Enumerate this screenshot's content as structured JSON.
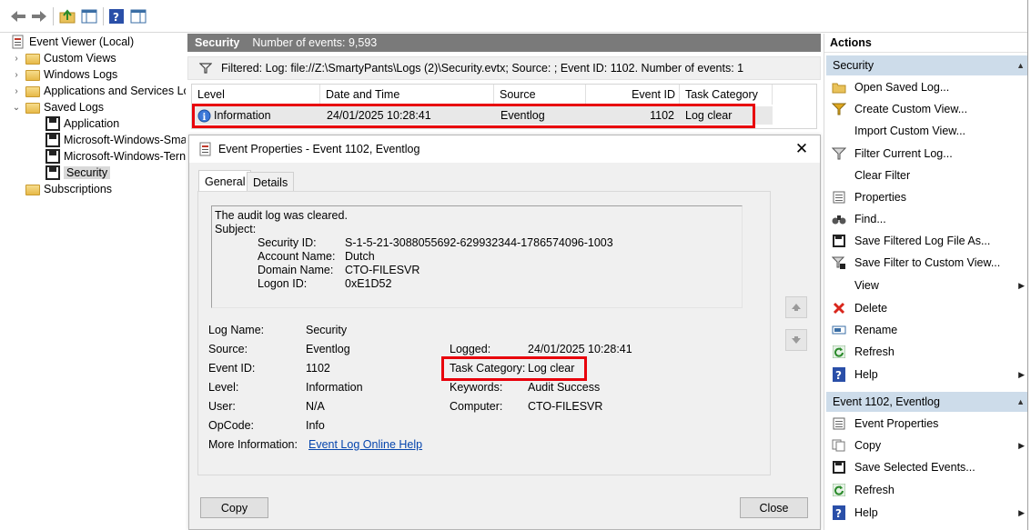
{
  "tree": {
    "root": "Event Viewer (Local)",
    "items": [
      {
        "label": "Custom Views",
        "icon": "folder-icon",
        "expander": "›"
      },
      {
        "label": "Windows Logs",
        "icon": "folder-icon",
        "expander": "›"
      },
      {
        "label": "Applications and Services Lo",
        "icon": "folder-icon",
        "expander": "›"
      },
      {
        "label": "Saved Logs",
        "icon": "folder-icon",
        "expander": "⌄"
      },
      {
        "label": "Application",
        "icon": "saved-log-icon"
      },
      {
        "label": "Microsoft-Windows-Sma",
        "icon": "saved-log-icon"
      },
      {
        "label": "Microsoft-Windows-Tern",
        "icon": "saved-log-icon"
      },
      {
        "label": "Security",
        "icon": "saved-log-icon",
        "selected": true
      },
      {
        "label": "Subscriptions",
        "icon": "subscriptions-icon"
      }
    ]
  },
  "center": {
    "title": "Security",
    "event_count": "Number of events: 9,593",
    "filter_text": "Filtered: Log: file://Z:\\SmartyPants\\Logs (2)\\Security.evtx; Source: ; Event ID: 1102. Number of events: 1",
    "columns": [
      "Level",
      "Date and Time",
      "Source",
      "Event ID",
      "Task Category"
    ],
    "row": {
      "level": "Information",
      "date": "24/01/2025 10:28:41",
      "source": "Eventlog",
      "event_id": "1102",
      "task": "Log clear"
    }
  },
  "dialog": {
    "title": "Event Properties - Event 1102, Eventlog",
    "tabs": [
      "General",
      "Details"
    ],
    "description": {
      "line1": "The audit log was cleared.",
      "line2": "Subject:",
      "fields": [
        {
          "k": "Security ID:",
          "v": "S-1-5-21-3088055692-629932344-1786574096-1003"
        },
        {
          "k": "Account Name:",
          "v": "Dutch"
        },
        {
          "k": "Domain Name:",
          "v": "CTO-FILESVR"
        },
        {
          "k": "Logon ID:",
          "v": "0xE1D52"
        }
      ]
    },
    "left_fields": [
      {
        "k": "Log Name:",
        "v": "Security"
      },
      {
        "k": "Source:",
        "v": "Eventlog"
      },
      {
        "k": "Event ID:",
        "v": "1102"
      },
      {
        "k": "Level:",
        "v": "Information"
      },
      {
        "k": "User:",
        "v": "N/A"
      },
      {
        "k": "OpCode:",
        "v": "Info"
      }
    ],
    "more_info_label": "More Information:",
    "more_info_link": "Event Log Online Help",
    "right_fields": [
      {
        "k": "Logged:",
        "v": "24/01/2025 10:28:41"
      },
      {
        "k": "Task Category:",
        "v": "Log clear"
      },
      {
        "k": "Keywords:",
        "v": "Audit Success"
      },
      {
        "k": "Computer:",
        "v": "CTO-FILESVR"
      }
    ],
    "copy_button": "Copy",
    "close_button": "Close"
  },
  "actions": {
    "title": "Actions",
    "section1": {
      "title": "Security",
      "items": [
        {
          "label": "Open Saved Log...",
          "icon": "open-folder-icon"
        },
        {
          "label": "Create Custom View...",
          "icon": "filter-star-icon"
        },
        {
          "label": "Import Custom View...",
          "icon": ""
        },
        {
          "label": "Filter Current Log...",
          "icon": "filter-icon"
        },
        {
          "label": "Clear Filter",
          "icon": ""
        },
        {
          "label": "Properties",
          "icon": "properties-icon"
        },
        {
          "label": "Find...",
          "icon": "binoculars-icon"
        },
        {
          "label": "Save Filtered Log File As...",
          "icon": "save-icon"
        },
        {
          "label": "Save Filter to Custom View...",
          "icon": "filter-save-icon"
        },
        {
          "label": "View",
          "icon": "",
          "submenu": true
        },
        {
          "label": "Delete",
          "icon": "delete-icon"
        },
        {
          "label": "Rename",
          "icon": "rename-icon"
        },
        {
          "label": "Refresh",
          "icon": "refresh-icon"
        },
        {
          "label": "Help",
          "icon": "help-icon",
          "submenu": true
        }
      ]
    },
    "section2": {
      "title": "Event 1102, Eventlog",
      "items": [
        {
          "label": "Event Properties",
          "icon": "properties-icon"
        },
        {
          "label": "Copy",
          "icon": "copy-icon",
          "submenu": true
        },
        {
          "label": "Save Selected Events...",
          "icon": "save-icon"
        },
        {
          "label": "Refresh",
          "icon": "refresh-icon"
        },
        {
          "label": "Help",
          "icon": "help-icon",
          "submenu": true
        }
      ]
    }
  },
  "colors": {
    "highlight_red": "#e8000b",
    "section_blue": "#cddcea",
    "header_gray": "#7a7a7a"
  }
}
